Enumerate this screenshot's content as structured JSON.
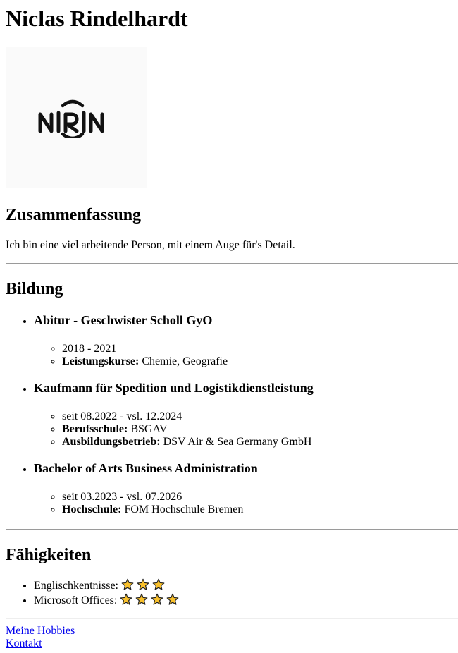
{
  "header": {
    "name": "Niclas Rindelhardt"
  },
  "logo": {
    "text": "NIRIN",
    "icon": "nirin-logo"
  },
  "summary": {
    "heading": "Zusammenfassung",
    "text": "Ich bin eine viel arbeitende Person, mit einem Auge für's Detail."
  },
  "education": {
    "heading": "Bildung",
    "items": [
      {
        "title": "Abitur - Geschwister Scholl GyO",
        "details": [
          {
            "label": "",
            "value": "2018 - 2021"
          },
          {
            "label": "Leistungskurse:",
            "value": " Chemie, Geografie"
          }
        ]
      },
      {
        "title": "Kaufmann für Spedition und Logistikdienstleistung",
        "details": [
          {
            "label": "",
            "value": "seit 08.2022 - vsl. 12.2024"
          },
          {
            "label": "Berufsschule:",
            "value": " BSGAV"
          },
          {
            "label": "Ausbildungsbetrieb:",
            "value": " DSV Air & Sea Germany GmbH"
          }
        ]
      },
      {
        "title": "Bachelor of Arts Business Administration",
        "details": [
          {
            "label": "",
            "value": "seit 03.2023 - vsl. 07.2026"
          },
          {
            "label": "Hochschule:",
            "value": " FOM Hochschule Bremen"
          }
        ]
      }
    ]
  },
  "skills": {
    "heading": "Fähigkeiten",
    "items": [
      {
        "label": "Englischkentnisse: ",
        "stars": 3
      },
      {
        "label": "Microsoft Offices: ",
        "stars": 4
      }
    ],
    "star_color": "#f9c02a",
    "star_outline": "#222222"
  },
  "links": [
    {
      "label": "Meine Hobbies"
    },
    {
      "label": "Kontakt"
    }
  ],
  "colors": {
    "link": "#0000ee",
    "text": "#000000",
    "background": "#ffffff"
  }
}
